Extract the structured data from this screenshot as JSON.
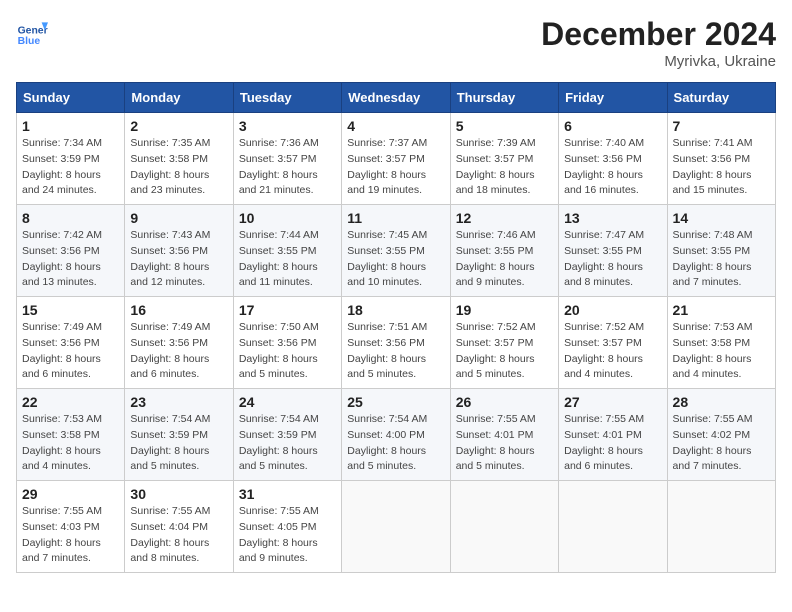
{
  "header": {
    "logo_line1": "General",
    "logo_line2": "Blue",
    "month": "December 2024",
    "location": "Myrivka, Ukraine"
  },
  "weekdays": [
    "Sunday",
    "Monday",
    "Tuesday",
    "Wednesday",
    "Thursday",
    "Friday",
    "Saturday"
  ],
  "weeks": [
    [
      {
        "day": "1",
        "sunrise": "7:34 AM",
        "sunset": "3:59 PM",
        "daylight": "8 hours and 24 minutes."
      },
      {
        "day": "2",
        "sunrise": "7:35 AM",
        "sunset": "3:58 PM",
        "daylight": "8 hours and 23 minutes."
      },
      {
        "day": "3",
        "sunrise": "7:36 AM",
        "sunset": "3:57 PM",
        "daylight": "8 hours and 21 minutes."
      },
      {
        "day": "4",
        "sunrise": "7:37 AM",
        "sunset": "3:57 PM",
        "daylight": "8 hours and 19 minutes."
      },
      {
        "day": "5",
        "sunrise": "7:39 AM",
        "sunset": "3:57 PM",
        "daylight": "8 hours and 18 minutes."
      },
      {
        "day": "6",
        "sunrise": "7:40 AM",
        "sunset": "3:56 PM",
        "daylight": "8 hours and 16 minutes."
      },
      {
        "day": "7",
        "sunrise": "7:41 AM",
        "sunset": "3:56 PM",
        "daylight": "8 hours and 15 minutes."
      }
    ],
    [
      {
        "day": "8",
        "sunrise": "7:42 AM",
        "sunset": "3:56 PM",
        "daylight": "8 hours and 13 minutes."
      },
      {
        "day": "9",
        "sunrise": "7:43 AM",
        "sunset": "3:56 PM",
        "daylight": "8 hours and 12 minutes."
      },
      {
        "day": "10",
        "sunrise": "7:44 AM",
        "sunset": "3:55 PM",
        "daylight": "8 hours and 11 minutes."
      },
      {
        "day": "11",
        "sunrise": "7:45 AM",
        "sunset": "3:55 PM",
        "daylight": "8 hours and 10 minutes."
      },
      {
        "day": "12",
        "sunrise": "7:46 AM",
        "sunset": "3:55 PM",
        "daylight": "8 hours and 9 minutes."
      },
      {
        "day": "13",
        "sunrise": "7:47 AM",
        "sunset": "3:55 PM",
        "daylight": "8 hours and 8 minutes."
      },
      {
        "day": "14",
        "sunrise": "7:48 AM",
        "sunset": "3:55 PM",
        "daylight": "8 hours and 7 minutes."
      }
    ],
    [
      {
        "day": "15",
        "sunrise": "7:49 AM",
        "sunset": "3:56 PM",
        "daylight": "8 hours and 6 minutes."
      },
      {
        "day": "16",
        "sunrise": "7:49 AM",
        "sunset": "3:56 PM",
        "daylight": "8 hours and 6 minutes."
      },
      {
        "day": "17",
        "sunrise": "7:50 AM",
        "sunset": "3:56 PM",
        "daylight": "8 hours and 5 minutes."
      },
      {
        "day": "18",
        "sunrise": "7:51 AM",
        "sunset": "3:56 PM",
        "daylight": "8 hours and 5 minutes."
      },
      {
        "day": "19",
        "sunrise": "7:52 AM",
        "sunset": "3:57 PM",
        "daylight": "8 hours and 5 minutes."
      },
      {
        "day": "20",
        "sunrise": "7:52 AM",
        "sunset": "3:57 PM",
        "daylight": "8 hours and 4 minutes."
      },
      {
        "day": "21",
        "sunrise": "7:53 AM",
        "sunset": "3:58 PM",
        "daylight": "8 hours and 4 minutes."
      }
    ],
    [
      {
        "day": "22",
        "sunrise": "7:53 AM",
        "sunset": "3:58 PM",
        "daylight": "8 hours and 4 minutes."
      },
      {
        "day": "23",
        "sunrise": "7:54 AM",
        "sunset": "3:59 PM",
        "daylight": "8 hours and 5 minutes."
      },
      {
        "day": "24",
        "sunrise": "7:54 AM",
        "sunset": "3:59 PM",
        "daylight": "8 hours and 5 minutes."
      },
      {
        "day": "25",
        "sunrise": "7:54 AM",
        "sunset": "4:00 PM",
        "daylight": "8 hours and 5 minutes."
      },
      {
        "day": "26",
        "sunrise": "7:55 AM",
        "sunset": "4:01 PM",
        "daylight": "8 hours and 5 minutes."
      },
      {
        "day": "27",
        "sunrise": "7:55 AM",
        "sunset": "4:01 PM",
        "daylight": "8 hours and 6 minutes."
      },
      {
        "day": "28",
        "sunrise": "7:55 AM",
        "sunset": "4:02 PM",
        "daylight": "8 hours and 7 minutes."
      }
    ],
    [
      {
        "day": "29",
        "sunrise": "7:55 AM",
        "sunset": "4:03 PM",
        "daylight": "8 hours and 7 minutes."
      },
      {
        "day": "30",
        "sunrise": "7:55 AM",
        "sunset": "4:04 PM",
        "daylight": "8 hours and 8 minutes."
      },
      {
        "day": "31",
        "sunrise": "7:55 AM",
        "sunset": "4:05 PM",
        "daylight": "8 hours and 9 minutes."
      },
      null,
      null,
      null,
      null
    ]
  ]
}
